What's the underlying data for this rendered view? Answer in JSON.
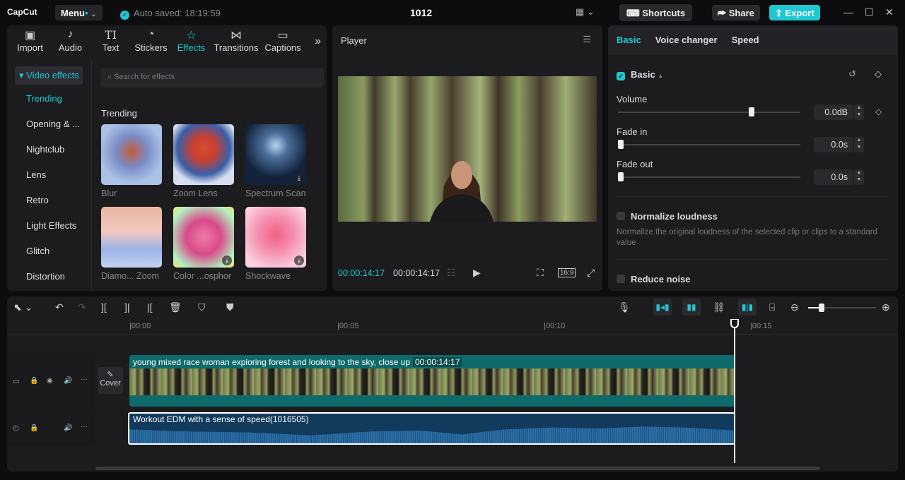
{
  "topbar": {
    "logo": "CapCut",
    "menu": "Menu",
    "autosave": "Auto saved: 18:19:59",
    "project_title": "1012",
    "shortcuts": "Shortcuts",
    "share": "Share",
    "export": "Export"
  },
  "media_tabs": [
    {
      "label": "Import",
      "icon": "▣"
    },
    {
      "label": "Audio",
      "icon": "♪"
    },
    {
      "label": "Text",
      "icon": "TI"
    },
    {
      "label": "Stickers",
      "icon": "◔"
    },
    {
      "label": "Effects",
      "icon": "☆"
    },
    {
      "label": "Transitions",
      "icon": "⋈"
    },
    {
      "label": "Captions",
      "icon": "▭"
    }
  ],
  "effects": {
    "category_header": "Video effects",
    "categories": [
      "Trending",
      "Opening & ...",
      "Nightclub",
      "Lens",
      "Retro",
      "Light Effects",
      "Glitch",
      "Distortion"
    ],
    "search_placeholder": "Search for effects",
    "section": "Trending",
    "items": [
      {
        "label": "Blur",
        "download": false
      },
      {
        "label": "Zoom Lens",
        "download": false
      },
      {
        "label": "Spectrum Scan",
        "download": true
      },
      {
        "label": "Diamo... Zoom",
        "download": false
      },
      {
        "label": "Color ...osphor",
        "download": true
      },
      {
        "label": "Shockwave",
        "download": true
      }
    ]
  },
  "player": {
    "title": "Player",
    "current_time": "00:00:14:17",
    "total_time": "00:00:14:17",
    "ratio": "16:9"
  },
  "properties": {
    "tabs": [
      "Basic",
      "Voice changer",
      "Speed"
    ],
    "basic_label": "Basic",
    "volume": {
      "label": "Volume",
      "value": "0.0dB",
      "fraction": 0.74
    },
    "fade_in": {
      "label": "Fade in",
      "value": "0.0s",
      "fraction": 0
    },
    "fade_out": {
      "label": "Fade out",
      "value": "0.0s",
      "fraction": 0
    },
    "normalize": {
      "label": "Normalize loudness",
      "desc": "Normalize the original loudness of the selected clip or clips to a standard value"
    },
    "reduce_noise": {
      "label": "Reduce noise"
    }
  },
  "timeline": {
    "ruler": [
      "|00:00",
      "|00:05",
      "|00:10",
      "|00:15"
    ],
    "cover_label": "Cover",
    "video_clip": {
      "title": "young mixed race woman exploring forest and looking to the sky, close up",
      "duration": "00:00:14:17"
    },
    "audio_clip": {
      "title": "Workout EDM with a sense of speed(1016505)"
    },
    "zoom_fraction": 0.2
  }
}
